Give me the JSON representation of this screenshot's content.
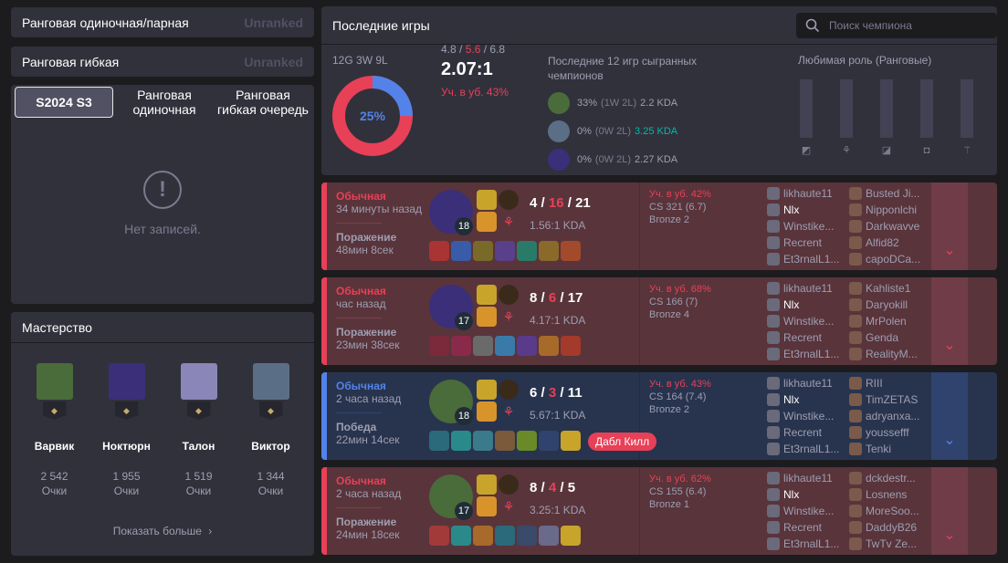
{
  "ranks": {
    "solo": {
      "title": "Ранговая одиночная/парная",
      "status": "Unranked"
    },
    "flex": {
      "title": "Ранговая гибкая",
      "status": "Unranked"
    }
  },
  "season_tabs": [
    "S2024 S3",
    "Ранговая\nодиночная",
    "Ранговая\nгибкая очередь"
  ],
  "no_records": "Нет записей.",
  "mastery": {
    "title": "Мастерство",
    "show_more": "Показать больше",
    "champions": [
      {
        "name": "Варвик",
        "points": "2 542",
        "points_label": "Очки",
        "color": "#4a6b3a"
      },
      {
        "name": "Ноктюрн",
        "points": "1 955",
        "points_label": "Очки",
        "color": "#3b2f7a"
      },
      {
        "name": "Талон",
        "points": "1 519",
        "points_label": "Очки",
        "color": "#8a86b8"
      },
      {
        "name": "Виктор",
        "points": "1 344",
        "points_label": "Очки",
        "color": "#5a6f86"
      }
    ]
  },
  "recent": {
    "title": "Последние игры",
    "search_placeholder": "Поиск чемпиона",
    "record": "12G 3W 9L",
    "winrate": "25%",
    "winrate_fraction": 0.25,
    "kda_k": "4.8",
    "kda_d": "5.6",
    "kda_a": "6.8",
    "kda_ratio": "2.07:1",
    "kill_participation": "Уч. в уб. 43%",
    "played_title": "Последние 12 игр сыгранных чемпионов",
    "played": [
      {
        "wr": "33%",
        "wl": "(1W 2L)",
        "kda": "2.2 KDA",
        "kda_color": "#9e9eb1",
        "color": "#4a6b3a"
      },
      {
        "wr": "0%",
        "wl": "(0W 2L)",
        "kda": "3.25 KDA",
        "kda_color": "#00bba3",
        "color": "#5a6f86"
      },
      {
        "wr": "0%",
        "wl": "(0W 2L)",
        "kda": "2.27 KDA",
        "kda_color": "#9e9eb1",
        "color": "#3b2f7a"
      }
    ],
    "fav_role_title": "Любимая роль (Ранговые)",
    "roles": [
      "top-role-icon",
      "jungle-role-icon",
      "mid-role-icon",
      "adc-role-icon",
      "support-role-icon"
    ]
  },
  "games": [
    {
      "result_class": "loss",
      "type": "Обычная",
      "ago": "34 минуты назад",
      "result": "Поражение",
      "duration": "48мин 8сек",
      "champ_color": "#3b2f7a",
      "level": "18",
      "k": "4",
      "d": "16",
      "a": "21",
      "kda": "1.56:1 KDA",
      "kp": "Уч. в уб. 42%",
      "cs": "CS 321 (6.7)",
      "rank": "Bronze 2",
      "multikill": "",
      "items": [
        "#a33",
        "#3a5ba8",
        "#7a6a2a",
        "#5a3f8a",
        "#2a7a6a",
        "#8a6a2a",
        "#a34a2a"
      ],
      "team1": [
        "likhaute11",
        "Nlx",
        "Winstike...",
        "Recrent",
        "Et3rnalL1..."
      ],
      "team2": [
        "Busted Ji...",
        "Nipponlchi",
        "Darkwavve",
        "Alfid82",
        "capoDCa..."
      ]
    },
    {
      "result_class": "loss",
      "type": "Обычная",
      "ago": "час назад",
      "result": "Поражение",
      "duration": "23мин 38сек",
      "champ_color": "#3b2f7a",
      "level": "17",
      "k": "8",
      "d": "6",
      "a": "17",
      "kda": "4.17:1 KDA",
      "kp": "Уч. в уб. 68%",
      "cs": "CS 166 (7)",
      "rank": "Bronze 4",
      "multikill": "",
      "items": [
        "#7a2a3a",
        "#8a2a4a",
        "#6a6a6a",
        "#3a7aa8",
        "#5a3a8a",
        "#a86a2a",
        "#a33a2a"
      ],
      "team1": [
        "likhaute11",
        "Nlx",
        "Winstike...",
        "Recrent",
        "Et3rnalL1..."
      ],
      "team2": [
        "Kahliste1",
        "Daryokill",
        "MrPolen",
        "Genda",
        "RealityM..."
      ]
    },
    {
      "result_class": "win",
      "type": "Обычная",
      "ago": "2 часа назад",
      "result": "Победа",
      "duration": "22мин 14сек",
      "champ_color": "#4a6b3a",
      "level": "18",
      "k": "6",
      "d": "3",
      "a": "11",
      "kda": "5.67:1 KDA",
      "kp": "Уч. в уб. 43%",
      "cs": "CS 164 (7.4)",
      "rank": "Bronze 2",
      "multikill": "Дабл Килл",
      "items": [
        "#2a6a7a",
        "#2a8a8a",
        "#3a7a8a",
        "#7a5a3a",
        "#6a8a2a",
        "#2f436e",
        "#c8a42a"
      ],
      "team1": [
        "likhaute11",
        "Nlx",
        "Winstike...",
        "Recrent",
        "Et3rnalL1..."
      ],
      "team2": [
        "RIII",
        "TimZETAS",
        "adryanxa...",
        "youssefff",
        "Tenki"
      ]
    },
    {
      "result_class": "loss",
      "type": "Обычная",
      "ago": "2 часа назад",
      "result": "Поражение",
      "duration": "24мин 18сек",
      "champ_color": "#4a6b3a",
      "level": "17",
      "k": "8",
      "d": "4",
      "a": "5",
      "kda": "3.25:1 KDA",
      "kp": "Уч. в уб. 62%",
      "cs": "CS 155 (6.4)",
      "rank": "Bronze 1",
      "multikill": "",
      "items": [
        "#a33a3a",
        "#2a8a8a",
        "#a86a2a",
        "#2a6a7a",
        "#3a4a6a",
        "#6a6a8a",
        "#c8a42a"
      ],
      "team1": [
        "likhaute11",
        "Nlx",
        "Winstike...",
        "Recrent",
        "Et3rnalL1..."
      ],
      "team2": [
        "dckdestr...",
        "Losnens",
        "MoreSoo...",
        "DaddyB26",
        "TwTv Ze..."
      ]
    }
  ]
}
